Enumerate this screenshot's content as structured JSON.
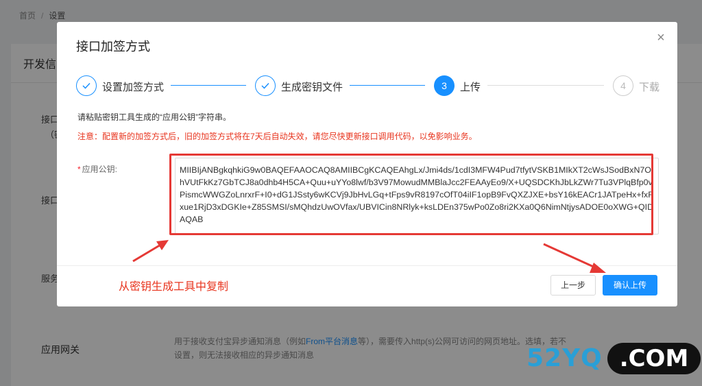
{
  "background": {
    "breadcrumb": {
      "home": "首页",
      "separator": "/",
      "current": "设置"
    },
    "card_title": "开发信",
    "row_labels": [
      "接口",
      "（密",
      "接口",
      "服务"
    ],
    "gateway": {
      "label": "应用网关",
      "description_prefix": "用于接收支付宝异步通知消息（例如",
      "description_link": "From平台消息",
      "description_suffix": "等），需要传入http(s)公网可访问的网页地址。选填，若不设置，则无法接收相应的异步通知消息"
    }
  },
  "modal": {
    "title": "接口加签方式",
    "close_glyph": "×",
    "steps": [
      {
        "label": "设置加签方式",
        "status": "done",
        "icon": "check-icon"
      },
      {
        "label": "生成密钥文件",
        "status": "done",
        "icon": "check-icon"
      },
      {
        "number": "3",
        "label": "上传",
        "status": "active"
      },
      {
        "number": "4",
        "label": "下载",
        "status": "wait"
      }
    ],
    "hint": "请粘贴密钥工具生成的“应用公钥”字符串。",
    "warning": "注意：配置新的加签方式后，旧的加签方式将在7天后自动失效，请您尽快更新接口调用代码，以免影响业务。",
    "field": {
      "required_mark": "*",
      "label": "应用公钥:",
      "value": "MIIBIjANBgkqhkiG9w0BAQEFAAOCAQ8AMIIBCgKCAQEAhgLx/Jmi4ds/1cdI3MFW4Pud7tfytVSKB1MIkXT2cWsJSodBxN7OhVUtFkKz7GbTCJ8a0dhb4H5CA+Quu+uYYo8lwf/b3V97MowudMMBlaJcc2FEAAyEo9/X+UQSDCKhJbLkZWr7Tu3VPlqBfp0vPismcWWGZoLnrxrF+I0+dG1JSsty6wKCVj9JbHvLGq+tFps9vR8197cOfT04iIF1opB9FvQXZJXE+bsY16kEACr1JATpeHx+fxFxue1RjD3xDGKIe+Z85SMSI/sMQhdzUwOVfax/UBVICin8NRlyk+ksLDEn375wPo0Zo8ri2KXa0Q6NimNtjysADOE0oXWG+QIDAQAB"
    },
    "annotation": "从密钥生成工具中复制",
    "buttons": {
      "prev": "上一步",
      "confirm": "确认上传"
    }
  },
  "watermark": {
    "left": "52YQ",
    "right": ".COM"
  },
  "colors": {
    "primary": "#1890ff",
    "warning": "#e8341e",
    "annotation_red": "#e53935",
    "watermark_blue": "#2a9fd6"
  }
}
